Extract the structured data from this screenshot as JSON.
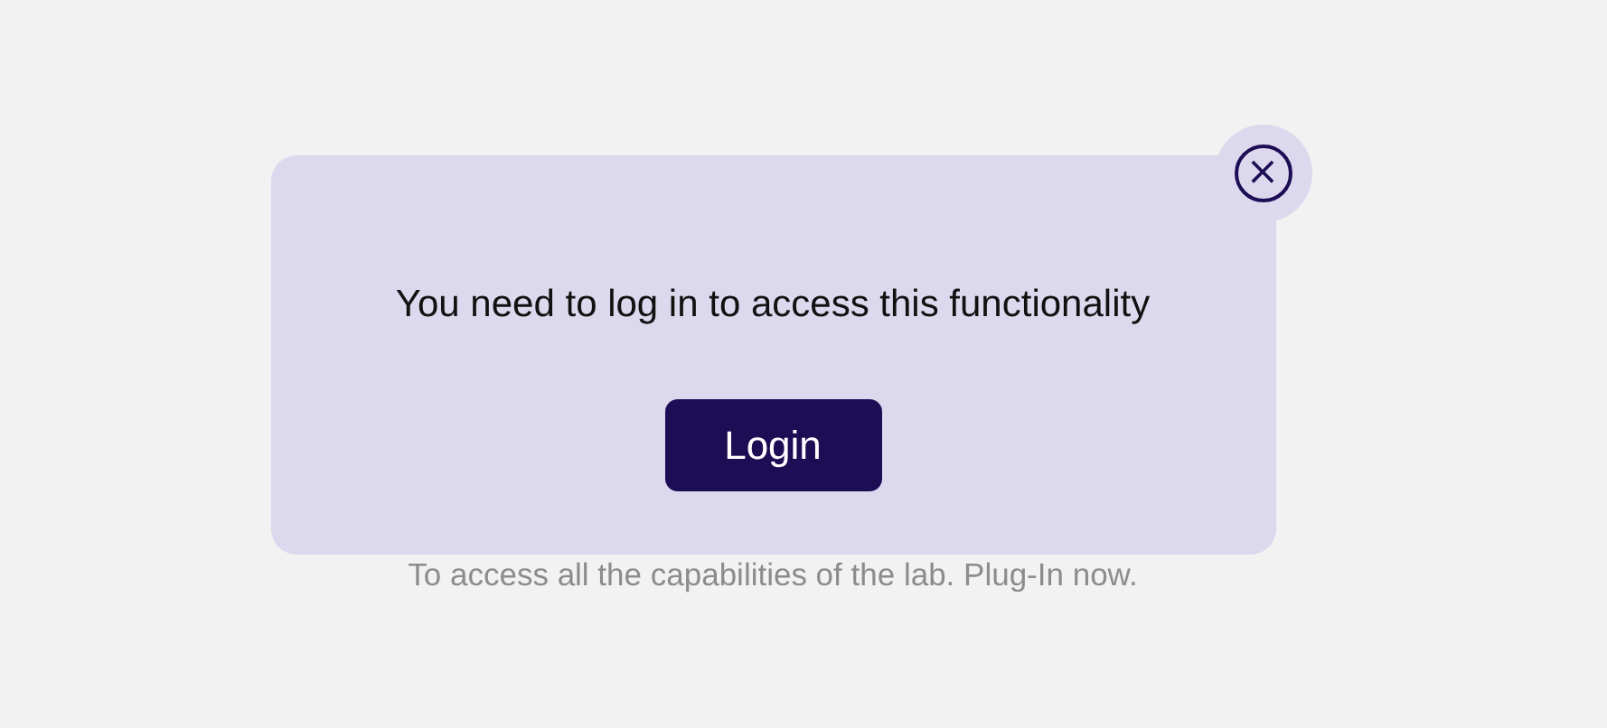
{
  "background": {
    "text": "To access all the capabilities of the lab. Plug-In now."
  },
  "dialog": {
    "message": "You need to log in to access this functionality",
    "close_button": {
      "label": "×"
    },
    "button": "Login"
  }
}
